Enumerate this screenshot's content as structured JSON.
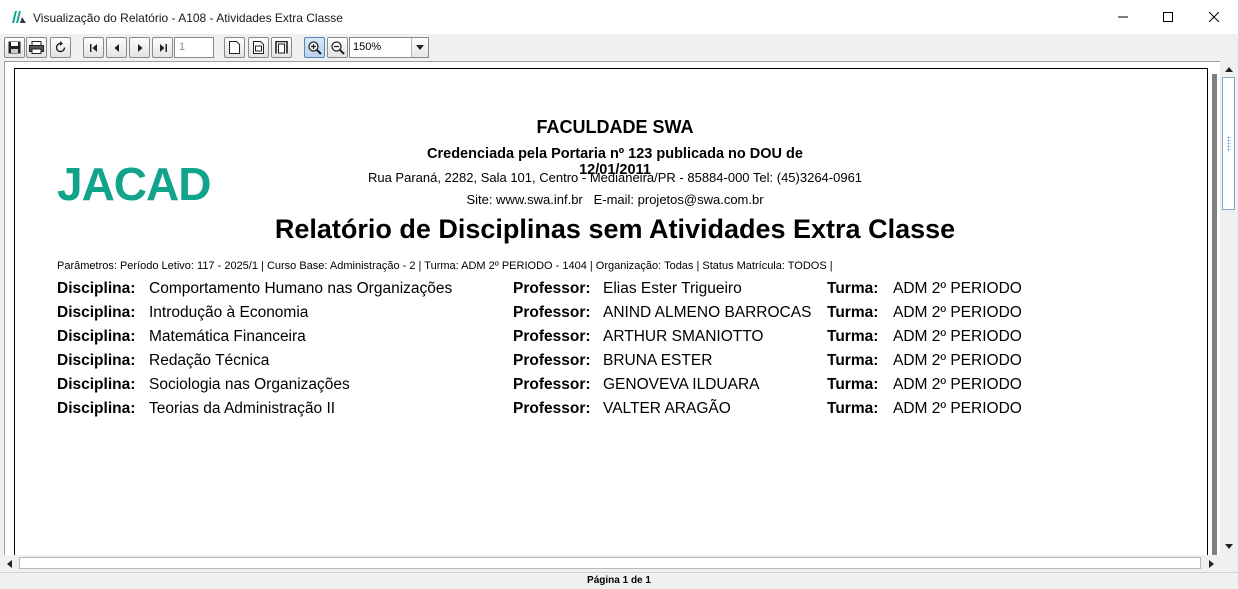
{
  "window": {
    "title": "Visualização do Relatório - A108 - Atividades Extra Classe"
  },
  "toolbar": {
    "page_number": "1",
    "zoom_value": "150%"
  },
  "report": {
    "institution": "FACULDADE SWA",
    "credential": "Credenciada pela Portaria nº 123 publicada no DOU de 12/01/2011",
    "address": "Rua Paraná, 2282, Sala 101, Centro - Medianeira/PR - 85884-000 Tel: (45)3264-0961",
    "site_email": "Site: www.swa.inf.br   E-mail: projetos@swa.com.br",
    "title": "Relatório de Disciplinas sem Atividades Extra Classe",
    "parameters": "Parâmetros:  Período Letivo: 117 - 2025/1 |  Curso Base: Administração - 2 |  Turma: ADM 2º PERIODO - 1404 | Organização: Todas |  Status Matrícula: TODOS |",
    "labels": {
      "disciplina": "Disciplina:",
      "professor": "Professor:",
      "turma": "Turma:"
    },
    "rows": [
      {
        "disciplina": "Comportamento Humano nas Organizações",
        "professor": "Elias Ester Trigueiro",
        "turma": "ADM 2º PERIODO"
      },
      {
        "disciplina": "Introdução à Economia",
        "professor": "ANIND ALMENO BARROCAS",
        "turma": "ADM 2º PERIODO"
      },
      {
        "disciplina": "Matemática Financeira",
        "professor": "ARTHUR SMANIOTTO",
        "turma": "ADM 2º PERIODO"
      },
      {
        "disciplina": "Redação Técnica",
        "professor": "BRUNA ESTER",
        "turma": "ADM 2º PERIODO"
      },
      {
        "disciplina": "Sociologia nas Organizações",
        "professor": "GENOVEVA ILDUARA",
        "turma": "ADM 2º PERIODO"
      },
      {
        "disciplina": "Teorias da Administração II",
        "professor": "VALTER ARAGÃO",
        "turma": "ADM 2º PERIODO"
      }
    ]
  },
  "logo": {
    "text": "JACAD",
    "color": "#12a38d",
    "dark": "#2f3b3b"
  },
  "status": {
    "page_text": "Página 1 de 1"
  }
}
